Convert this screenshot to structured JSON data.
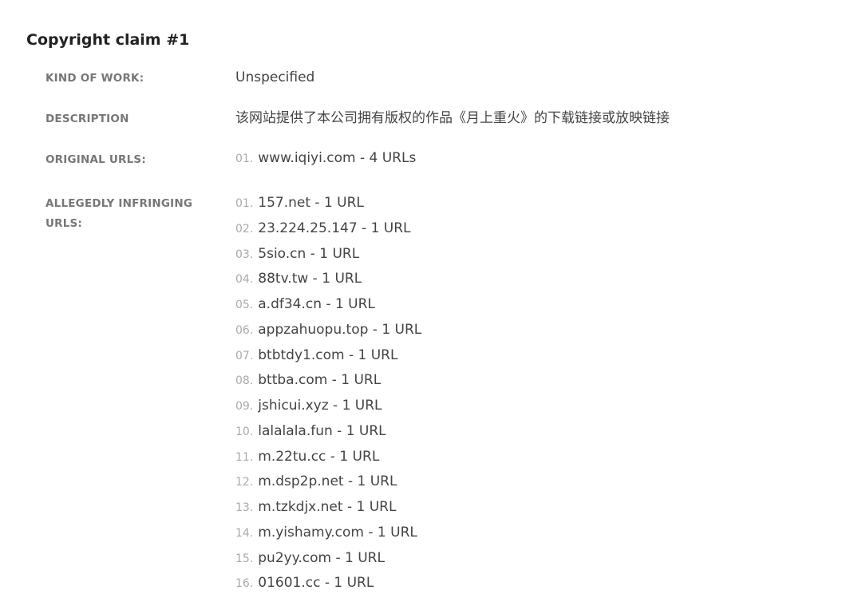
{
  "claim": {
    "title": "Copyright claim #1",
    "kind_of_work": {
      "label": "KIND OF WORK:",
      "value": "Unspecified"
    },
    "description": {
      "label": "DESCRIPTION",
      "value": "该网站提供了本公司拥有版权的作品《月上重火》的下载链接或放映链接"
    },
    "original_urls": {
      "label": "ORIGINAL URLS:",
      "items": [
        {
          "num": "01.",
          "text": "www.iqiyi.com - 4 URLs"
        }
      ]
    },
    "infringing_urls": {
      "label": "ALLEGEDLY INFRINGING URLS:",
      "items": [
        {
          "num": "01.",
          "text": "157.net - 1 URL"
        },
        {
          "num": "02.",
          "text": "23.224.25.147 - 1 URL"
        },
        {
          "num": "03.",
          "text": "5sio.cn - 1 URL"
        },
        {
          "num": "04.",
          "text": "88tv.tw - 1 URL"
        },
        {
          "num": "05.",
          "text": "a.df34.cn - 1 URL"
        },
        {
          "num": "06.",
          "text": "appzahuopu.top - 1 URL"
        },
        {
          "num": "07.",
          "text": "btbtdy1.com - 1 URL"
        },
        {
          "num": "08.",
          "text": "bttba.com - 1 URL"
        },
        {
          "num": "09.",
          "text": "jshicui.xyz - 1 URL"
        },
        {
          "num": "10.",
          "text": "lalalala.fun - 1 URL"
        },
        {
          "num": "11.",
          "text": "m.22tu.cc - 1 URL"
        },
        {
          "num": "12.",
          "text": "m.dsp2p.net - 1 URL"
        },
        {
          "num": "13.",
          "text": "m.tzkdjx.net - 1 URL"
        },
        {
          "num": "14.",
          "text": "m.yishamy.com - 1 URL"
        },
        {
          "num": "15.",
          "text": "pu2yy.com - 1 URL"
        },
        {
          "num": "16.",
          "text": "01601.cc - 1 URL"
        }
      ]
    }
  }
}
